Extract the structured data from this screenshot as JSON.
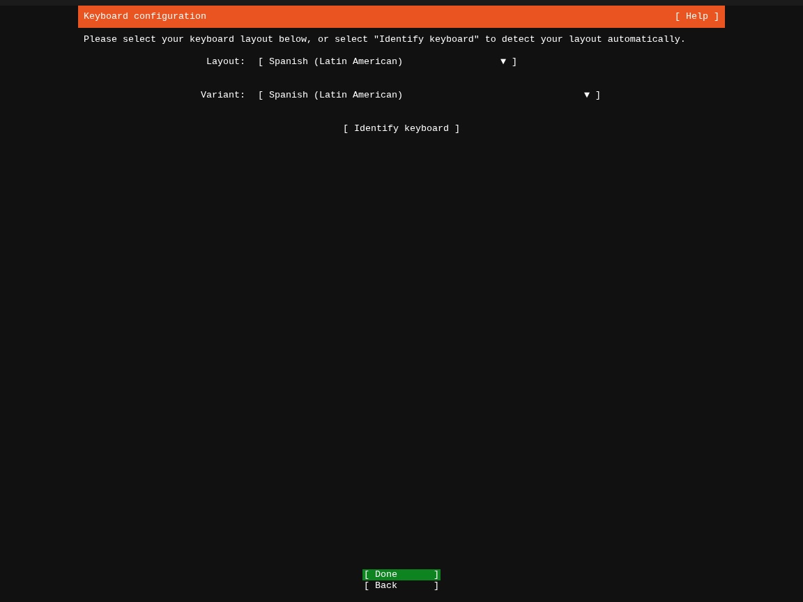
{
  "header": {
    "title": "Keyboard configuration",
    "help": "[ Help ]"
  },
  "description": "Please select your keyboard layout below, or select \"Identify keyboard\" to detect your layout automatically.",
  "fields": [
    {
      "label": "Layout:",
      "open": "[",
      "value": "Spanish (Latin American)",
      "arrow": "▼",
      "close": "]"
    },
    {
      "label": "Variant:",
      "open": "[",
      "value": "Spanish (Latin American)",
      "arrow": "▼",
      "close": "]"
    }
  ],
  "identify_button": "[ Identify keyboard ]",
  "buttons": [
    {
      "open": "[",
      "label": "Done",
      "close": "]",
      "selected": true
    },
    {
      "open": "[",
      "label": "Back",
      "close": "]",
      "selected": false
    }
  ]
}
